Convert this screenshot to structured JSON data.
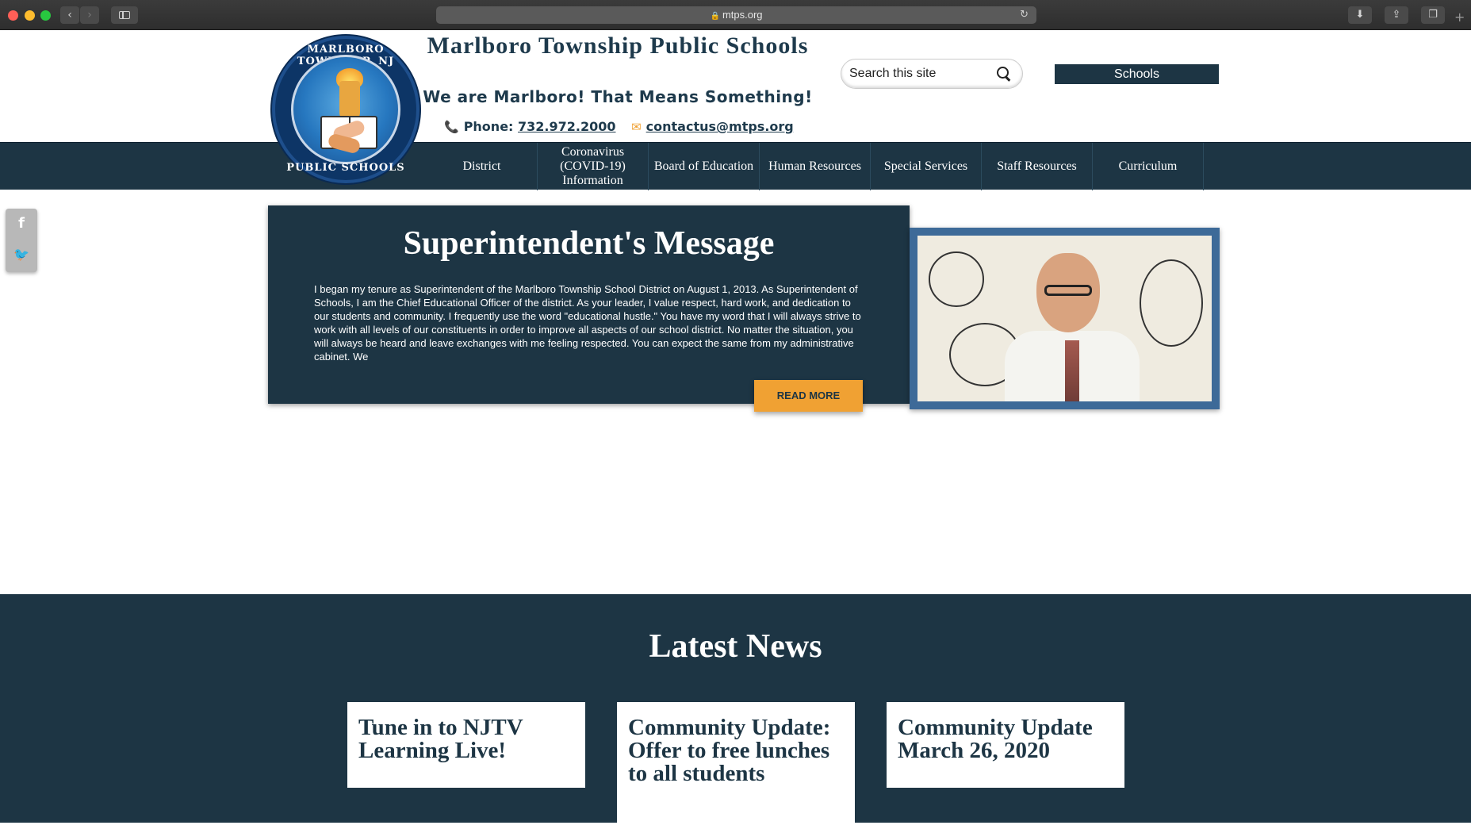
{
  "browser": {
    "url": "mtps.org",
    "back_glyph": "‹",
    "forward_glyph": "›"
  },
  "header": {
    "logo_text_top": "MARLBORO TOWNSHIP, NJ",
    "logo_text_bottom": "PUBLIC SCHOOLS",
    "title": "Marlboro Township Public Schools",
    "tagline": "We are Marlboro! That Means Something!",
    "phone_label": "Phone:",
    "phone": "732.972.2000",
    "email": "contactus@mtps.org",
    "search_placeholder": "Search this site",
    "schools_label": "Schools"
  },
  "nav": {
    "items": [
      {
        "label": "District"
      },
      {
        "label": "Coronavirus (COVID-19) Information"
      },
      {
        "label": "Board of Education"
      },
      {
        "label": "Human Resources"
      },
      {
        "label": "Special Services"
      },
      {
        "label": "Staff Resources"
      },
      {
        "label": "Curriculum"
      }
    ]
  },
  "superintendent": {
    "heading": "Superintendent's Message",
    "body": "I began my tenure as Superintendent of the Marlboro Township School District on August 1, 2013.  As Superintendent of Schools, I am the Chief Educational Officer of the district.  As your leader, I value respect, hard work, and dedication to our students and community.  I frequently use the word \"educational hustle.\"  You have my word that I will always strive to work with all levels of our constituents in order to improve all aspects of our school district. No matter the situation, you will always be heard and leave exchanges with me feeling respected. You can expect the same from my administrative cabinet.  We",
    "read_more": "READ MORE"
  },
  "news": {
    "heading": "Latest News",
    "cards": [
      {
        "title": "Tune in to NJTV Learning Live!"
      },
      {
        "title": "Community Update: Offer to free lunches to all students"
      },
      {
        "title": "Community Update March 26, 2020"
      }
    ]
  },
  "colors": {
    "navy": "#1d3544",
    "accent_orange": "#f0a133"
  },
  "icons": {
    "facebook": "f",
    "twitter": "🐦"
  }
}
